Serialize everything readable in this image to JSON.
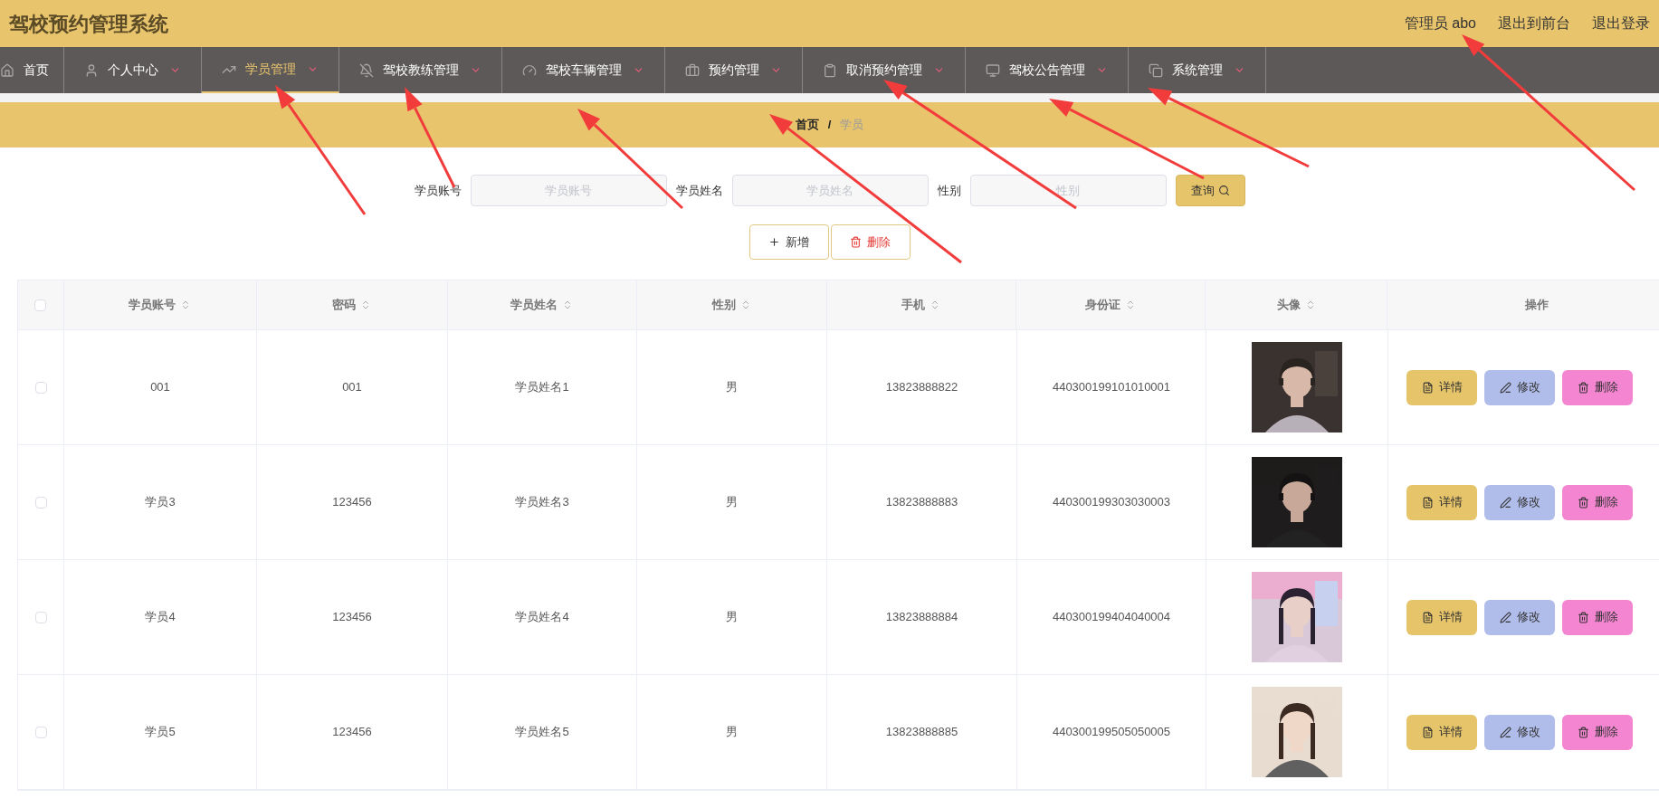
{
  "header": {
    "title": "驾校预约管理系统",
    "links": [
      "管理员 abo",
      "退出到前台",
      "退出登录"
    ]
  },
  "nav": [
    {
      "label": "首页",
      "selected": false,
      "dropdown": false
    },
    {
      "label": "个人中心",
      "selected": false,
      "dropdown": true
    },
    {
      "label": "学员管理",
      "selected": true,
      "dropdown": true
    },
    {
      "label": "驾校教练管理",
      "selected": false,
      "dropdown": true
    },
    {
      "label": "驾校车辆管理",
      "selected": false,
      "dropdown": true
    },
    {
      "label": "预约管理",
      "selected": false,
      "dropdown": true
    },
    {
      "label": "取消预约管理",
      "selected": false,
      "dropdown": true
    },
    {
      "label": "驾校公告管理",
      "selected": false,
      "dropdown": true
    },
    {
      "label": "系统管理",
      "selected": false,
      "dropdown": true
    }
  ],
  "breadcrumb": {
    "home": "首页",
    "separator": "/",
    "current": "学员"
  },
  "search": {
    "fields": [
      {
        "label": "学员账号",
        "placeholder": "学员账号"
      },
      {
        "label": "学员姓名",
        "placeholder": "学员姓名"
      },
      {
        "label": "性别",
        "placeholder": "性别"
      }
    ],
    "button": "查询"
  },
  "actions": {
    "add": "新增",
    "delete": "删除"
  },
  "table": {
    "header_checked": false,
    "columns": [
      {
        "label": "学员账号",
        "sortable": true
      },
      {
        "label": "密码",
        "sortable": true
      },
      {
        "label": "学员姓名",
        "sortable": true
      },
      {
        "label": "性别",
        "sortable": true
      },
      {
        "label": "手机",
        "sortable": true
      },
      {
        "label": "身份证",
        "sortable": true
      },
      {
        "label": "头像",
        "sortable": true
      },
      {
        "label": "操作",
        "sortable": false
      }
    ],
    "rows": [
      {
        "checked": false,
        "cells": [
          "001",
          "001",
          "学员姓名1",
          "男",
          "13823888822",
          "440300199101010001"
        ],
        "avatar": {
          "kind": "picture"
        },
        "buttons": [
          "详情",
          "修改",
          "删除"
        ]
      },
      {
        "checked": false,
        "cells": [
          "学员3",
          "123456",
          "学员姓名3",
          "男",
          "13823888883",
          "440300199303030003"
        ],
        "avatar": {
          "kind": "picture"
        },
        "buttons": [
          "详情",
          "修改",
          "删除"
        ]
      },
      {
        "checked": false,
        "cells": [
          "学员4",
          "123456",
          "学员姓名4",
          "男",
          "13823888884",
          "440300199404040004"
        ],
        "avatar": {
          "kind": "picture"
        },
        "buttons": [
          "详情",
          "修改",
          "删除"
        ]
      },
      {
        "checked": false,
        "cells": [
          "学员5",
          "123456",
          "学员姓名5",
          "男",
          "13823888885",
          "440300199505050005"
        ],
        "avatar": {
          "kind": "picture"
        },
        "buttons": [
          "详情",
          "修改",
          "删除"
        ]
      }
    ]
  }
}
